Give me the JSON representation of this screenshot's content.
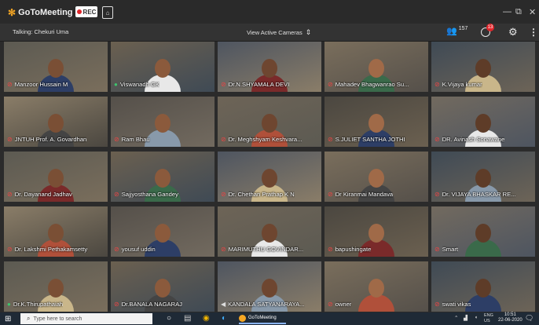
{
  "app": {
    "title": "GoToMeeting",
    "rec_label": "REC"
  },
  "window_controls": [
    "—",
    "⧉",
    "✕"
  ],
  "subbar": {
    "talking": "Talking: Chekuri Uma",
    "view_cameras": "View Active Cameras",
    "attendee_count": "157",
    "chat_badge": "13"
  },
  "participants": [
    {
      "name": "Manzoor Hussain M",
      "mic": "muted"
    },
    {
      "name": "Viswanadh GK",
      "mic": "on"
    },
    {
      "name": "Dr.N.SHYAMALA DEVI",
      "mic": "muted"
    },
    {
      "name": "Mahadev Bhagwanrao Su...",
      "mic": "muted"
    },
    {
      "name": "K.Vijaya kumar",
      "mic": "muted"
    },
    {
      "name": "JNTUH Prof. A. Govardhan",
      "mic": "muted"
    },
    {
      "name": "Ram Bhau",
      "mic": "muted"
    },
    {
      "name": "Dr. Meghshyam Keshvara...",
      "mic": "muted"
    },
    {
      "name": "S.JULIET SANTHA JOTHI",
      "mic": "muted"
    },
    {
      "name": "DR. Avinash Sonawane",
      "mic": "muted"
    },
    {
      "name": "Dr. Dayanand Jadhav",
      "mic": "muted"
    },
    {
      "name": "Sajjyosthana Gandey",
      "mic": "muted"
    },
    {
      "name": "Dr. Chethan Prathap K N",
      "mic": "muted"
    },
    {
      "name": "Dr Kiranmai Mandava",
      "mic": "muted"
    },
    {
      "name": "Dr. VIJAYA BHASKAR RE...",
      "mic": "muted"
    },
    {
      "name": "Dr. Lakshmi Pethakamsetty",
      "mic": "muted"
    },
    {
      "name": "yousuf uddin",
      "mic": "muted"
    },
    {
      "name": "MARIMUTHU GOVINDAR...",
      "mic": "muted"
    },
    {
      "name": "bapushingate",
      "mic": "muted"
    },
    {
      "name": "Smart",
      "mic": "muted"
    },
    {
      "name": "Dr.K.Thirupathaiah",
      "mic": "on"
    },
    {
      "name": "Dr.BANALA NAGARAJ",
      "mic": "muted"
    },
    {
      "name": "KANDALA SATYANARAYA...",
      "mic": "speaker"
    },
    {
      "name": "owner",
      "mic": "muted"
    },
    {
      "name": "swati vikas",
      "mic": "muted"
    }
  ],
  "taskbar": {
    "search_placeholder": "Type here to search",
    "gotomeeting_label": "GoToMeeting",
    "lang": "ENG",
    "region": "US",
    "time": "10:51",
    "date": "22-06-2020"
  }
}
